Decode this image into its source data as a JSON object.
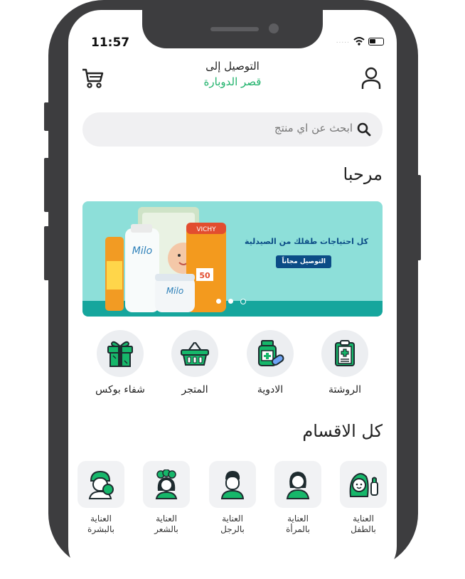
{
  "status_bar": {
    "time": "11:57",
    "signal_label": "....."
  },
  "header": {
    "deliver_to": "التوصيل إلى",
    "location": "قصر الدوبارة"
  },
  "search": {
    "placeholder": "ابحث عن اي منتج"
  },
  "welcome": "مرحبا",
  "banner": {
    "headline": "كل احتياجات طفلك من الصيدلية",
    "cta": "التوصيل مجاناً",
    "active_slide": 3,
    "slide_count": 3,
    "product_labels": {
      "left": "Milo",
      "right": "VICHY",
      "spf": "50",
      "tin": "Milo"
    }
  },
  "quick_actions": [
    {
      "label": "الروشتة",
      "icon": "prescription-icon"
    },
    {
      "label": "الادوية",
      "icon": "medicine-icon"
    },
    {
      "label": "المتجر",
      "icon": "basket-icon"
    },
    {
      "label": "شفاء بوكس",
      "icon": "gift-icon"
    }
  ],
  "categories_title": "كل الاقسام",
  "categories": [
    {
      "line1": "العناية",
      "line2": "بالطفل",
      "icon": "baby-care-icon"
    },
    {
      "line1": "العناية",
      "line2": "بالمرأة",
      "icon": "woman-care-icon"
    },
    {
      "line1": "العناية",
      "line2": "بالرجل",
      "icon": "man-care-icon"
    },
    {
      "line1": "العناية",
      "line2": "بالشعر",
      "icon": "hair-care-icon"
    },
    {
      "line1": "العناية",
      "line2": "بالبشرة",
      "icon": "skin-care-icon"
    }
  ],
  "colors": {
    "accent": "#1fb26b",
    "icon_green": "#16b76a",
    "frame": "#3d3d3f",
    "banner_bg": "#8ddfd9",
    "banner_band": "#16a69d"
  }
}
